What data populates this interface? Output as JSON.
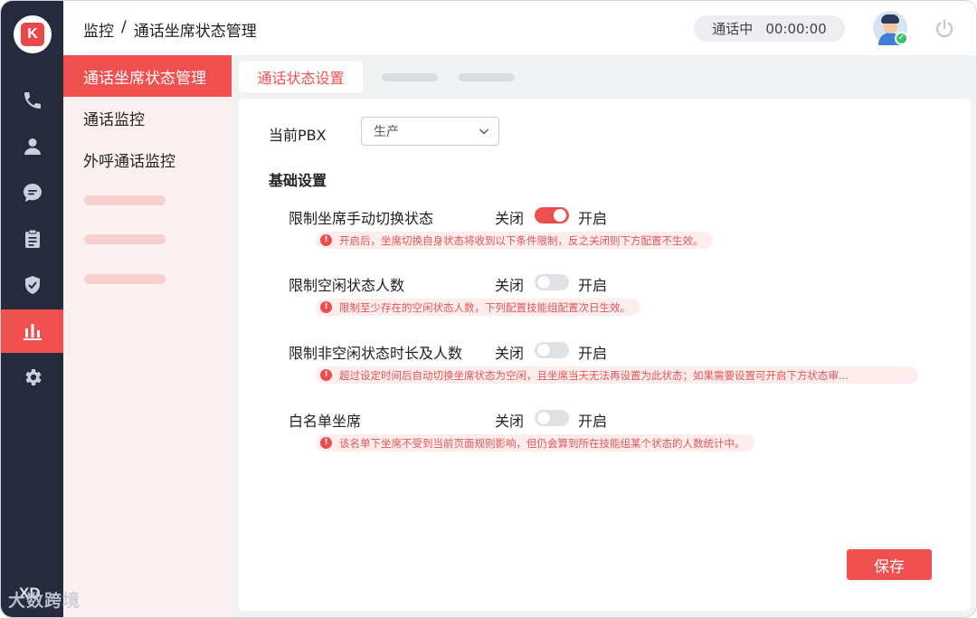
{
  "app": {
    "logo_text": "K"
  },
  "rail": {
    "items": [
      {
        "icon": "phone-icon"
      },
      {
        "icon": "user-icon"
      },
      {
        "icon": "chat-icon"
      },
      {
        "icon": "clipboard-icon"
      },
      {
        "icon": "shield-icon"
      },
      {
        "icon": "bar-chart-icon",
        "active": true
      },
      {
        "icon": "gear-icon"
      }
    ],
    "bottom_logo": "XD"
  },
  "header": {
    "breadcrumb_root": "监控",
    "breadcrumb_sep": "/",
    "breadcrumb_page": "通话坐席状态管理",
    "call_status": "通话中",
    "call_timer": "00:00:00"
  },
  "subnav": {
    "items": [
      {
        "label": "通话坐席状态管理",
        "active": true
      },
      {
        "label": "通话监控"
      },
      {
        "label": "外呼通话监控"
      }
    ]
  },
  "tabs": {
    "active_label": "通话状态设置"
  },
  "form": {
    "pbx_label": "当前PBX",
    "pbx_value": "生产",
    "section_title": "基础设置",
    "off_label": "关闭",
    "on_label": "开启",
    "settings": [
      {
        "label": "限制坐席手动切换状态",
        "enabled": true,
        "tip": "开启后，坐席切换自身状态将收到以下条件限制，反之关闭则下方配置不生效。"
      },
      {
        "label": "限制空闲状态人数",
        "enabled": false,
        "tip": "限制至少存在的空闲状态人数，下列配置技能组配置次日生效。"
      },
      {
        "label": "限制非空闲状态时长及人数",
        "enabled": false,
        "tip": "超过设定时间后自动切换坐席状态为空闲，且坐席当天无法再设置为此状态；如果需要设置可开启下方状态审..."
      },
      {
        "label": "白名单坐席",
        "enabled": false,
        "tip": "该名单下坐席不受到当前页面规则影响，但仍会算到所在技能组某个状态的人数统计中。"
      }
    ],
    "save_label": "保存"
  },
  "watermark": "大数跨境",
  "colors": {
    "accent": "#f0504f",
    "rail_bg": "#252b3d",
    "subnav_bg": "#fdf0f0"
  }
}
